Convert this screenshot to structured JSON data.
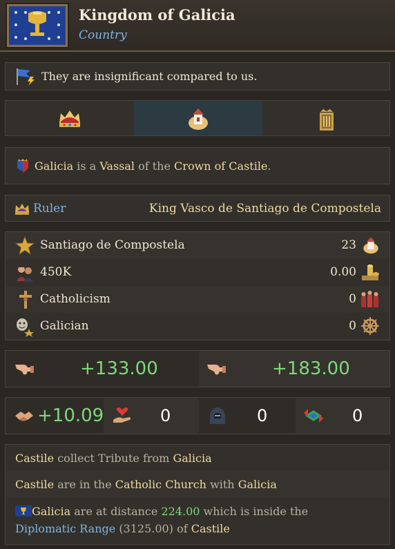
{
  "header": {
    "title": "Kingdom of Galicia",
    "subtitle": "Country"
  },
  "opinion": {
    "text": "They are insignificant compared to us."
  },
  "tabs": [
    {
      "icon": "crown-icon",
      "active": false
    },
    {
      "icon": "town-icon",
      "active": true
    },
    {
      "icon": "banner-crest-icon",
      "active": false
    }
  ],
  "vassal": {
    "subject": "Galicia",
    "is_a": "is a",
    "relation": "Vassal",
    "of_the": "of the",
    "overlord": "Crown of Castile",
    "period": "."
  },
  "ruler": {
    "label": "Ruler",
    "name": "King Vasco de Santiago de Compostela"
  },
  "stats": [
    {
      "label": "Santiago de Compostela",
      "value": "23"
    },
    {
      "label": "450K",
      "value": "0.00"
    },
    {
      "label": "Catholicism",
      "value": "0"
    },
    {
      "label": "Galician",
      "value": "0"
    }
  ],
  "balances": {
    "left": "+133.00",
    "right": "+183.00"
  },
  "relations": {
    "trust": "+10.09",
    "favors": "0",
    "spies": "0",
    "maps": "0"
  },
  "info": {
    "tribute": {
      "a": "Castile",
      "b": "collect Tribute from",
      "c": "Galicia"
    },
    "church": {
      "a": "Castile",
      "b": "are in the",
      "c": "Catholic Church",
      "d": "with",
      "e": "Galicia"
    },
    "distance": {
      "a": "Galicia",
      "b": "are at distance",
      "dist": "224.00",
      "c": "which is inside the",
      "range_label": "Diplomatic Range",
      "range": "(3125.00)",
      "d": "of",
      "e": "Castile"
    }
  }
}
